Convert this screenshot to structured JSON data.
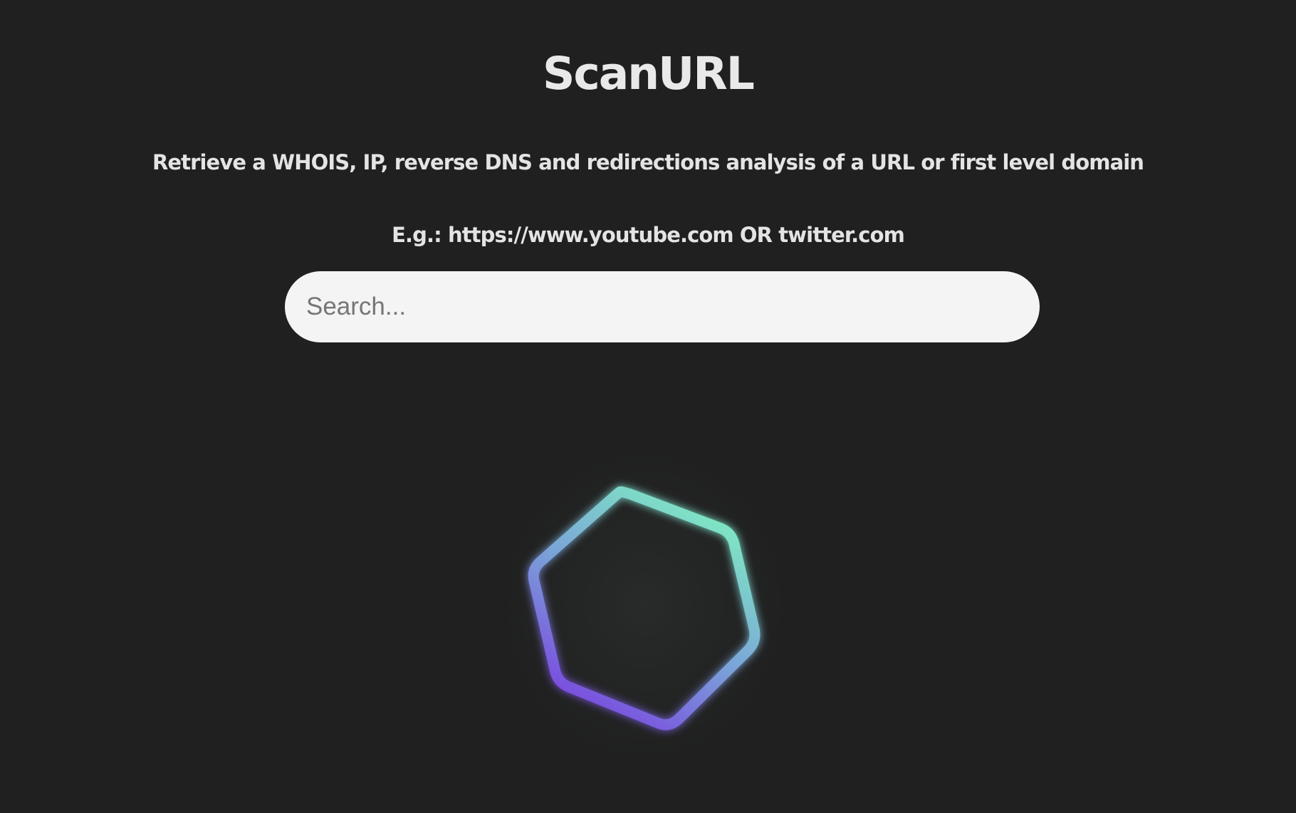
{
  "header": {
    "title": "ScanURL",
    "subtitle": "Retrieve a WHOIS, IP, reverse DNS and redirections analysis of a URL or first level domain",
    "example": "E.g.: https://www.youtube.com OR twitter.com"
  },
  "search": {
    "placeholder": "Search...",
    "value": ""
  },
  "loader": {
    "icon": "hexagon-loader-icon",
    "gradient_start": "#7a3fe0",
    "gradient_end": "#7ff0c0"
  },
  "colors": {
    "background": "#202020",
    "text": "#e6e6e6",
    "search_background": "#f4f4f4"
  }
}
